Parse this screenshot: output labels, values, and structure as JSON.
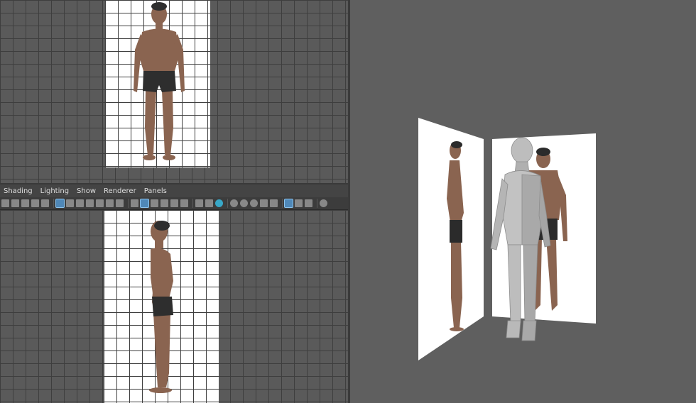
{
  "menu": {
    "items": [
      "Shading",
      "Lighting",
      "Show",
      "Renderer",
      "Panels"
    ]
  },
  "toolbar": {
    "icons": [
      "camera-select-icon",
      "bookmark-icon",
      "image-plane-icon",
      "grease-pencil-icon",
      "camera-attr-icon",
      "grid-icon",
      "film-gate-icon",
      "resolution-gate-icon",
      "gate-mask-icon",
      "field-chart-icon",
      "safe-action-icon",
      "safe-title-icon",
      "pan-zoom-icon",
      "wireframe-icon",
      "smooth-shade-icon",
      "use-default-material-icon",
      "wireframe-on-shaded-icon",
      "xray-icon",
      "xray-joints-icon",
      "use-all-lights-icon",
      "shadows-icon",
      "screen-space-ao-icon",
      "motion-blur-icon",
      "multisample-aa-icon",
      "depth-of-field-icon",
      "isolate-select-icon",
      "xray-active-icon",
      "two-pane-icon",
      "four-pane-icon",
      "resize-icon",
      "hud-icon"
    ]
  },
  "colors": {
    "viewport": "#5a5a5a",
    "grid_line": "#3e3e3e",
    "menubar": "#444444",
    "toolbar": "#3c3c3c",
    "selected_tool": "#4f88b8",
    "mannequin": "#b4b4b4"
  }
}
